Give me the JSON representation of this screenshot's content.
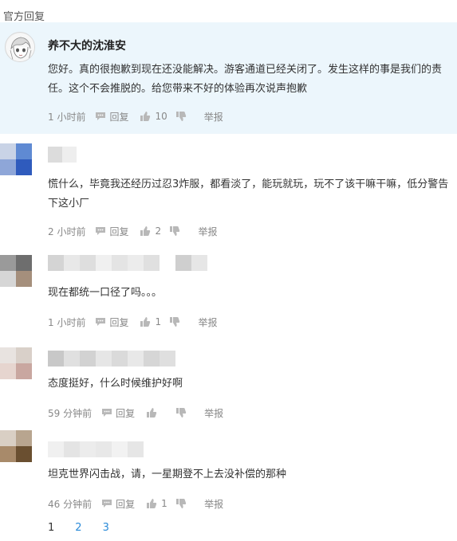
{
  "section": {
    "official_label": "官方回复"
  },
  "official": {
    "author": "养不大的沈淮安",
    "text": "您好。真的很抱歉到现在还没能解决。游客通道已经关闭了。发生这样的事是我们的责任。这个不会推脱的。给您带来不好的体验再次说声抱歉",
    "time": "1 小时前",
    "reply_label": "回复",
    "likes": "10",
    "report_label": "举报"
  },
  "comments": [
    {
      "text": "慌什么，毕竟我还经历过忍3炸服，都看淡了，能玩就玩，玩不了该干嘛干嘛，低分警告下这小厂",
      "time": "2 小时前",
      "reply_label": "回复",
      "likes": "2",
      "report_label": "举报"
    },
    {
      "text": "现在都统一口径了吗。。。",
      "time": "1 小时前",
      "reply_label": "回复",
      "likes": "1",
      "report_label": "举报"
    },
    {
      "text": "态度挺好，什么时候维护好啊",
      "time": "59 分钟前",
      "reply_label": "回复",
      "likes": "",
      "report_label": "举报"
    },
    {
      "text": "坦克世界闪击战，请，一星期登不上去没补偿的那种",
      "time": "46 分钟前",
      "reply_label": "回复",
      "likes": "1",
      "report_label": "举报"
    }
  ],
  "pagination": {
    "pages": [
      "1",
      "2",
      "3"
    ],
    "current": "1"
  },
  "colors": {
    "official_bg": "#ecf6fc",
    "link": "#2a8ad8",
    "meta_text": "#888888",
    "icon": "#b8b8b8"
  }
}
